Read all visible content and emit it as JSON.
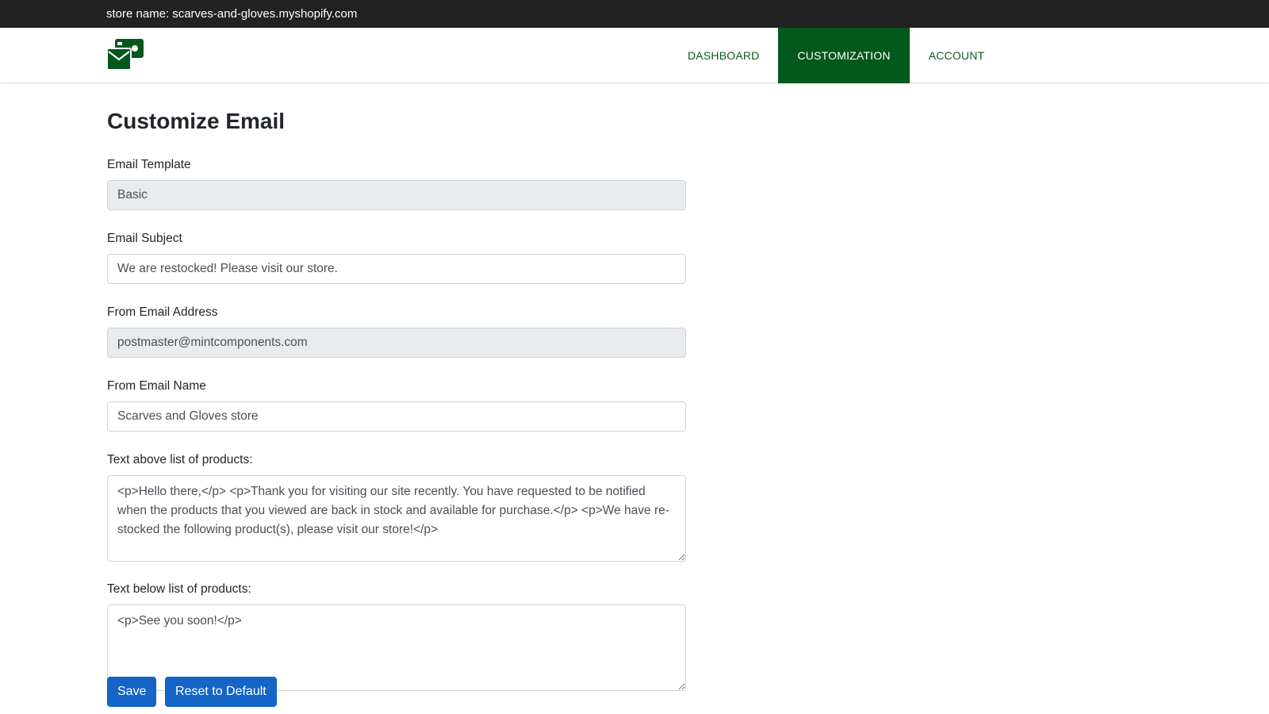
{
  "topbar": {
    "store_prefix": "store name:",
    "store_name": "scarves-and-gloves.myshopify.com"
  },
  "nav": {
    "items": [
      {
        "label": "DASHBOARD",
        "active": false
      },
      {
        "label": "CUSTOMIZATION",
        "active": true
      },
      {
        "label": "ACCOUNT",
        "active": false
      }
    ]
  },
  "colors": {
    "brand_green": "#03581b",
    "nav_text_green": "#0e5a1f",
    "topbar_bg": "#222222",
    "button_blue": "#1565c8"
  },
  "page": {
    "title": "Customize Email"
  },
  "form": {
    "template": {
      "label": "Email Template",
      "value": "Basic"
    },
    "subject": {
      "label": "Email Subject",
      "value": "We are restocked! Please visit our store."
    },
    "from_address": {
      "label": "From Email Address",
      "value": "postmaster@mintcomponents.com"
    },
    "from_name": {
      "label": "From Email Name",
      "value": "Scarves and Gloves store"
    },
    "text_above": {
      "label": "Text above list of products:",
      "value": "<p>Hello there,</p> <p>Thank you for visiting our site recently. You have requested to be notified when the products that you viewed are back in stock and available for purchase.</p> <p>We have re-stocked the following product(s), please visit our store!</p>"
    },
    "text_below": {
      "label": "Text below list of products:",
      "value": "<p>See you soon!</p>"
    }
  },
  "buttons": {
    "save_label": "Save",
    "reset_label": "Reset to Default"
  },
  "icons": {
    "logo": "envelope-money-logo-icon"
  }
}
